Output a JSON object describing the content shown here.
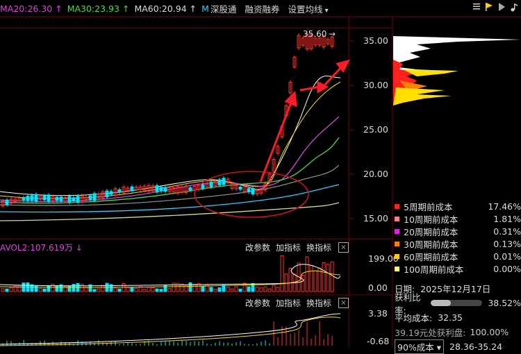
{
  "header": {
    "ma_items": [
      {
        "label": "MA20:26.30",
        "arrow": "↑",
        "color": "#e040e0"
      },
      {
        "label": "MA30:23.93",
        "arrow": "↑",
        "color": "#40e040"
      },
      {
        "label": "MA60:20.94",
        "arrow": "↑",
        "color": "#dddddd"
      },
      {
        "label": "M",
        "arrow": "",
        "color": "#2ad0ff"
      }
    ],
    "buttons": [
      "深股通",
      "融资融券",
      "设置均线"
    ],
    "icons": [
      "list-icon",
      "flag-icon",
      "play-icon",
      "music-icon"
    ]
  },
  "price_panel": {
    "axis_labels": [
      "35.00",
      "30.00",
      "25.00",
      "20.00",
      "15.00"
    ],
    "max_marker": "35.60",
    "max_arrow": "→"
  },
  "volume_panel": {
    "title": "AVOL2:107.619万",
    "title_arrow": "↓",
    "buttons": [
      "改参数",
      "加指标",
      "换指标"
    ],
    "close": "×",
    "axis_labels": [
      "199.00",
      "0.00"
    ]
  },
  "indicator_panel": {
    "buttons": [
      "改参数",
      "加指标",
      "换指标"
    ],
    "close": "×",
    "axis_labels": [
      "3.38",
      "-0.68"
    ]
  },
  "cost_legend": [
    {
      "name": "5周期前成本",
      "value": "17.46%",
      "color": "#ff2020"
    },
    {
      "name": "10周期前成本",
      "value": "1.81%",
      "color": "#ff8080"
    },
    {
      "name": "20周期前成本",
      "value": "0.31%",
      "color": "#e020e0"
    },
    {
      "name": "30周期前成本",
      "value": "0.13%",
      "color": "#ff8000"
    },
    {
      "name": "60周期前成本",
      "value": "0.01%",
      "color": "#ffd000"
    },
    {
      "name": "100周期前成本",
      "value": "0.00%",
      "color": "#ffff80"
    }
  ],
  "stats": {
    "date_label": "日期:",
    "date_value": "2025年12月17日",
    "profit_label": "获利比率:",
    "profit_value": "38.52%",
    "profit_fraction": 0.3852,
    "avg_label": "平均成本:",
    "avg_value": "32.35",
    "profit_at_label": "39.19元处获利盘:",
    "profit_at_value": "100.00%",
    "range_select": "90%成本",
    "range_value": "28.36-35.24"
  },
  "colors": {
    "up": "#ff3030",
    "down": "#00e5ff",
    "grid": "#7a0000",
    "axis_text": "#dddddd"
  }
}
